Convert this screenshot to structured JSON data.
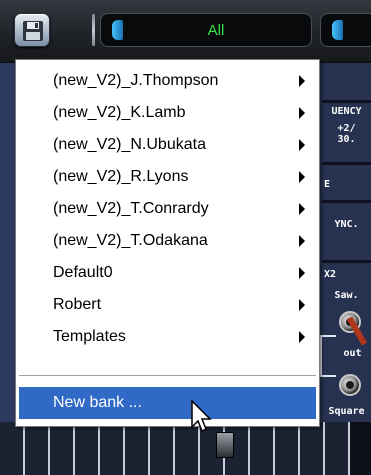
{
  "toolbar": {
    "preset_bank": "All",
    "save_icon": "floppy-disk-icon"
  },
  "menu": {
    "items": [
      {
        "label": "(new_V2)_J.Thompson",
        "submenu": true
      },
      {
        "label": "(new_V2)_K.Lamb",
        "submenu": true
      },
      {
        "label": "(new_V2)_N.Ubukata",
        "submenu": true
      },
      {
        "label": "(new_V2)_R.Lyons",
        "submenu": true
      },
      {
        "label": "(new_V2)_T.Conrardy",
        "submenu": true
      },
      {
        "label": "(new_V2)_T.Odakana",
        "submenu": true
      },
      {
        "label": "Default0",
        "submenu": true
      },
      {
        "label": "Robert",
        "submenu": true
      },
      {
        "label": "Templates",
        "submenu": true
      }
    ],
    "action": {
      "label": "New bank ...",
      "selected": true
    }
  },
  "panel": {
    "frequency_label": "UENCY",
    "range_label_1": "+2/",
    "range_label_2": "30.",
    "e_label": "E",
    "sync_label": "YNC.",
    "x2_label": "X2",
    "saw_label": "Saw.",
    "out_label": "out",
    "square_label": "Square"
  },
  "colors": {
    "menu_highlight": "#3169c6",
    "preset_text": "#36e24a",
    "panel_bg": "#2c3a5e"
  }
}
